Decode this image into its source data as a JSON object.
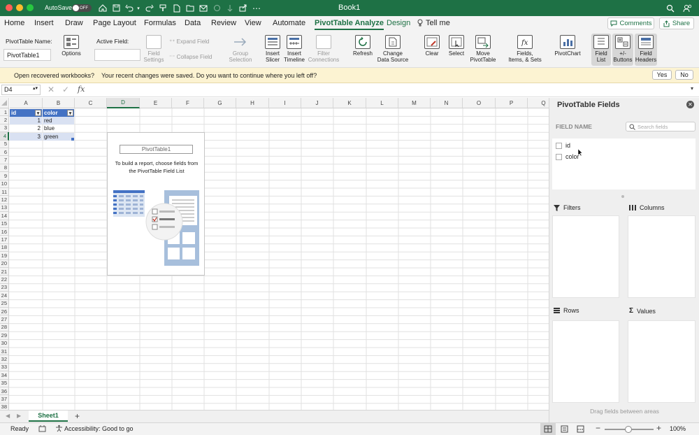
{
  "titlebar": {
    "autosave_label": "AutoSave",
    "autosave_state": "OFF",
    "doc_title": "Book1"
  },
  "tabs": [
    "Home",
    "Insert",
    "Draw",
    "Page Layout",
    "Formulas",
    "Data",
    "Review",
    "View",
    "Automate",
    "PivotTable Analyze",
    "Design"
  ],
  "tell_me": "Tell me",
  "comments_label": "Comments",
  "share_label": "Share",
  "ribbon": {
    "pt_name_label": "PivotTable Name:",
    "pt_name_value": "PivotTable1",
    "options": "Options",
    "active_field_label": "Active Field:",
    "field_settings_1": "Field",
    "field_settings_2": "Settings",
    "expand_field": "Expand Field",
    "collapse_field": "Collapse Field",
    "group_sel_1": "Group",
    "group_sel_2": "Selection",
    "insert_slicer_1": "Insert",
    "insert_slicer_2": "Slicer",
    "insert_timeline_1": "Insert",
    "insert_timeline_2": "Timeline",
    "filter_conn_1": "Filter",
    "filter_conn_2": "Connections",
    "refresh": "Refresh",
    "change_ds_1": "Change",
    "change_ds_2": "Data Source",
    "clear": "Clear",
    "select": "Select",
    "move_pt_1": "Move",
    "move_pt_2": "PivotTable",
    "fields_items_1": "Fields,",
    "fields_items_2": "Items, & Sets",
    "pivotchart": "PivotChart",
    "field_list_1": "Field",
    "field_list_2": "List",
    "pm_buttons_1": "+/-",
    "pm_buttons_2": "Buttons",
    "field_headers_1": "Field",
    "field_headers_2": "Headers"
  },
  "message_bar": {
    "title": "Open recovered workbooks?",
    "text": "Your recent changes were saved. Do you want to continue where you left off?",
    "yes": "Yes",
    "no": "No"
  },
  "formula_bar": {
    "name_box": "D4",
    "fx": "fx"
  },
  "columns": [
    "A",
    "B",
    "C",
    "D",
    "E",
    "F",
    "G",
    "H",
    "I",
    "J",
    "K",
    "L",
    "M",
    "N",
    "O",
    "P",
    "Q"
  ],
  "rows": [
    "1",
    "2",
    "3",
    "4",
    "5",
    "6",
    "7",
    "8",
    "9",
    "10",
    "11",
    "12",
    "13",
    "14",
    "15",
    "16",
    "17",
    "18",
    "19",
    "20",
    "21",
    "22",
    "23",
    "24",
    "25",
    "26",
    "27",
    "28",
    "29",
    "30",
    "31",
    "32",
    "33",
    "34",
    "35",
    "36",
    "37",
    "38"
  ],
  "table": {
    "headers": [
      "id",
      "color"
    ],
    "rows": [
      [
        "1",
        "red"
      ],
      [
        "2",
        "blue"
      ],
      [
        "3",
        "green"
      ]
    ]
  },
  "pivot_placeholder": {
    "name": "PivotTable1",
    "line1": "To build a report, choose fields from",
    "line2": "the PivotTable Field List"
  },
  "panel": {
    "title": "PivotTable Fields",
    "field_name_header": "FIELD NAME",
    "search_placeholder": "Search fields",
    "fields": [
      "id",
      "color"
    ],
    "filters": "Filters",
    "columns": "Columns",
    "rows": "Rows",
    "values": "Values",
    "hint": "Drag fields between areas"
  },
  "sheet_tab": "Sheet1",
  "status": {
    "ready": "Ready",
    "accessibility": "Accessibility: Good to go",
    "zoom": "100%"
  },
  "colors": {
    "excel_green": "#1e7145",
    "table_header": "#4472c4",
    "table_band": "#d9e1f2",
    "message_bar": "#fcf3d2"
  }
}
